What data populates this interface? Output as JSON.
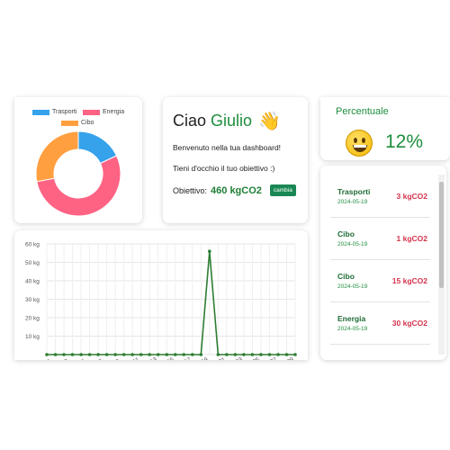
{
  "donut": {
    "legend": [
      "Trasporti",
      "Energia",
      "Cibo"
    ],
    "colors": {
      "Trasporti": "#36a2eb",
      "Energia": "#ff6384",
      "Cibo": "#ff9f40"
    },
    "chart_data": {
      "type": "pie",
      "categories": [
        "Trasporti",
        "Energia",
        "Cibo"
      ],
      "values": [
        18,
        54,
        28
      ]
    }
  },
  "welcome": {
    "greeting": "Ciao",
    "name": "Giulio",
    "line1": "Benvenuto nella tua dashboard!",
    "line2": "Tieni d'occhio il tuo obiettivo :)",
    "goal_label": "Obiettivo:",
    "goal_value": "460 kgCO2",
    "change_button": "cambia"
  },
  "percent": {
    "title": "Percentuale",
    "value": "12%"
  },
  "entries": [
    {
      "category": "Trasporti",
      "date": "2024-05-19",
      "amount": "3 kgCO2"
    },
    {
      "category": "Cibo",
      "date": "2024-05-19",
      "amount": "1 kgCO2"
    },
    {
      "category": "Cibo",
      "date": "2024-05-19",
      "amount": "15 kgCO2"
    },
    {
      "category": "Energia",
      "date": "2024-05-19",
      "amount": "30 kgCO2"
    }
  ],
  "chart_data": {
    "type": "line",
    "x": [
      "1",
      "",
      "3",
      "",
      "5",
      "",
      "7",
      "",
      "9",
      "",
      "11",
      "",
      "13",
      "",
      "15",
      "",
      "17",
      "",
      "19",
      "",
      "21",
      "",
      "23",
      "",
      "25",
      "",
      "27",
      "",
      "29",
      ""
    ],
    "values": [
      0,
      0,
      0,
      0,
      0,
      0,
      0,
      0,
      0,
      0,
      0,
      0,
      0,
      0,
      0,
      0,
      0,
      0,
      0,
      56,
      0,
      0,
      0,
      0,
      0,
      0,
      0,
      0,
      0,
      0
    ],
    "ylim": [
      0,
      60
    ],
    "yticks": [
      "0 kg",
      "10 kg",
      "20 kg",
      "30 kg",
      "40 kg",
      "50 kg",
      "60 kg"
    ],
    "grid": true,
    "color": "#2e7d32"
  }
}
